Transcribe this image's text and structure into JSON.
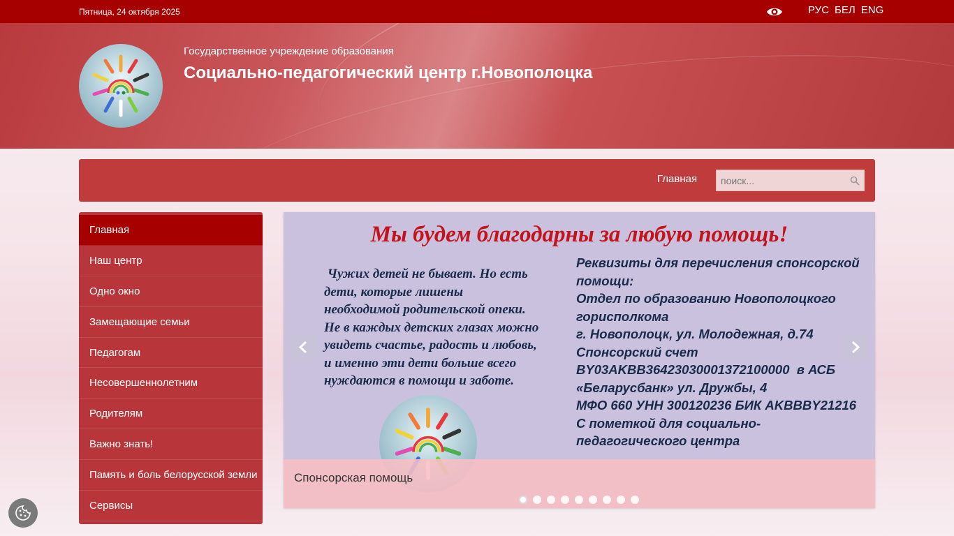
{
  "topbar": {
    "date": "Пятница, 24 октября 2025",
    "eye_icon": "eye-icon",
    "languages": [
      "РУС",
      "БЕЛ",
      "ENG"
    ]
  },
  "header": {
    "subtitle": "Государственное учреждение образования",
    "title": "Социально-педагогический центр г.Новополоцка"
  },
  "navbar": {
    "home_label": "Главная",
    "search_placeholder": "поиск...",
    "search_icon": "search-icon"
  },
  "sidebar": {
    "items": [
      {
        "label": "Главная",
        "active": true
      },
      {
        "label": "Наш центр"
      },
      {
        "label": "Одно окно"
      },
      {
        "label": "Замещающие семьи"
      },
      {
        "label": "Педагогам"
      },
      {
        "label": "Несовершеннолетним"
      },
      {
        "label": "Родителям"
      },
      {
        "label": "Важно знать!"
      },
      {
        "label": "Память и боль белорусской земли"
      },
      {
        "label": "Сервисы"
      }
    ]
  },
  "slider": {
    "heading": "Мы будем благодарны за любую помощь!",
    "left_lines": [
      " Чужих детей не бывает. Но есть",
      "дети, которые лишены",
      "необходимой родительской опеки.",
      "Не в каждых детских глазах можно",
      "увидеть счастье, радость и любовь,",
      "и именно эти дети больше всего",
      "нуждаются в помощи и заботе."
    ],
    "right_lines": [
      "Реквизиты для перечисления спонсорской",
      "помощи:",
      "Отдел по образованию Новополоцкого",
      "горисполкома",
      "г. Новополоцк, ул. Молодежная, д.74",
      "Спонсорский счет",
      "BY03AKBB36423030001372100000  в АСБ",
      "«Беларусбанк» ул. Дружбы, 4",
      "МФО 660 УНН 300120236 БИК AKBBBY21216",
      "С пометкой для социально-",
      "педагогического центра"
    ],
    "caption": "Спонсорская помощь",
    "dots_count": 9,
    "active_dot": 0
  },
  "colors": {
    "topbar": "#a60000",
    "navbar": "#bf3b3c",
    "menu": "#b8363a",
    "menu_active": "#a60000",
    "slide_heading": "#c4131a"
  }
}
